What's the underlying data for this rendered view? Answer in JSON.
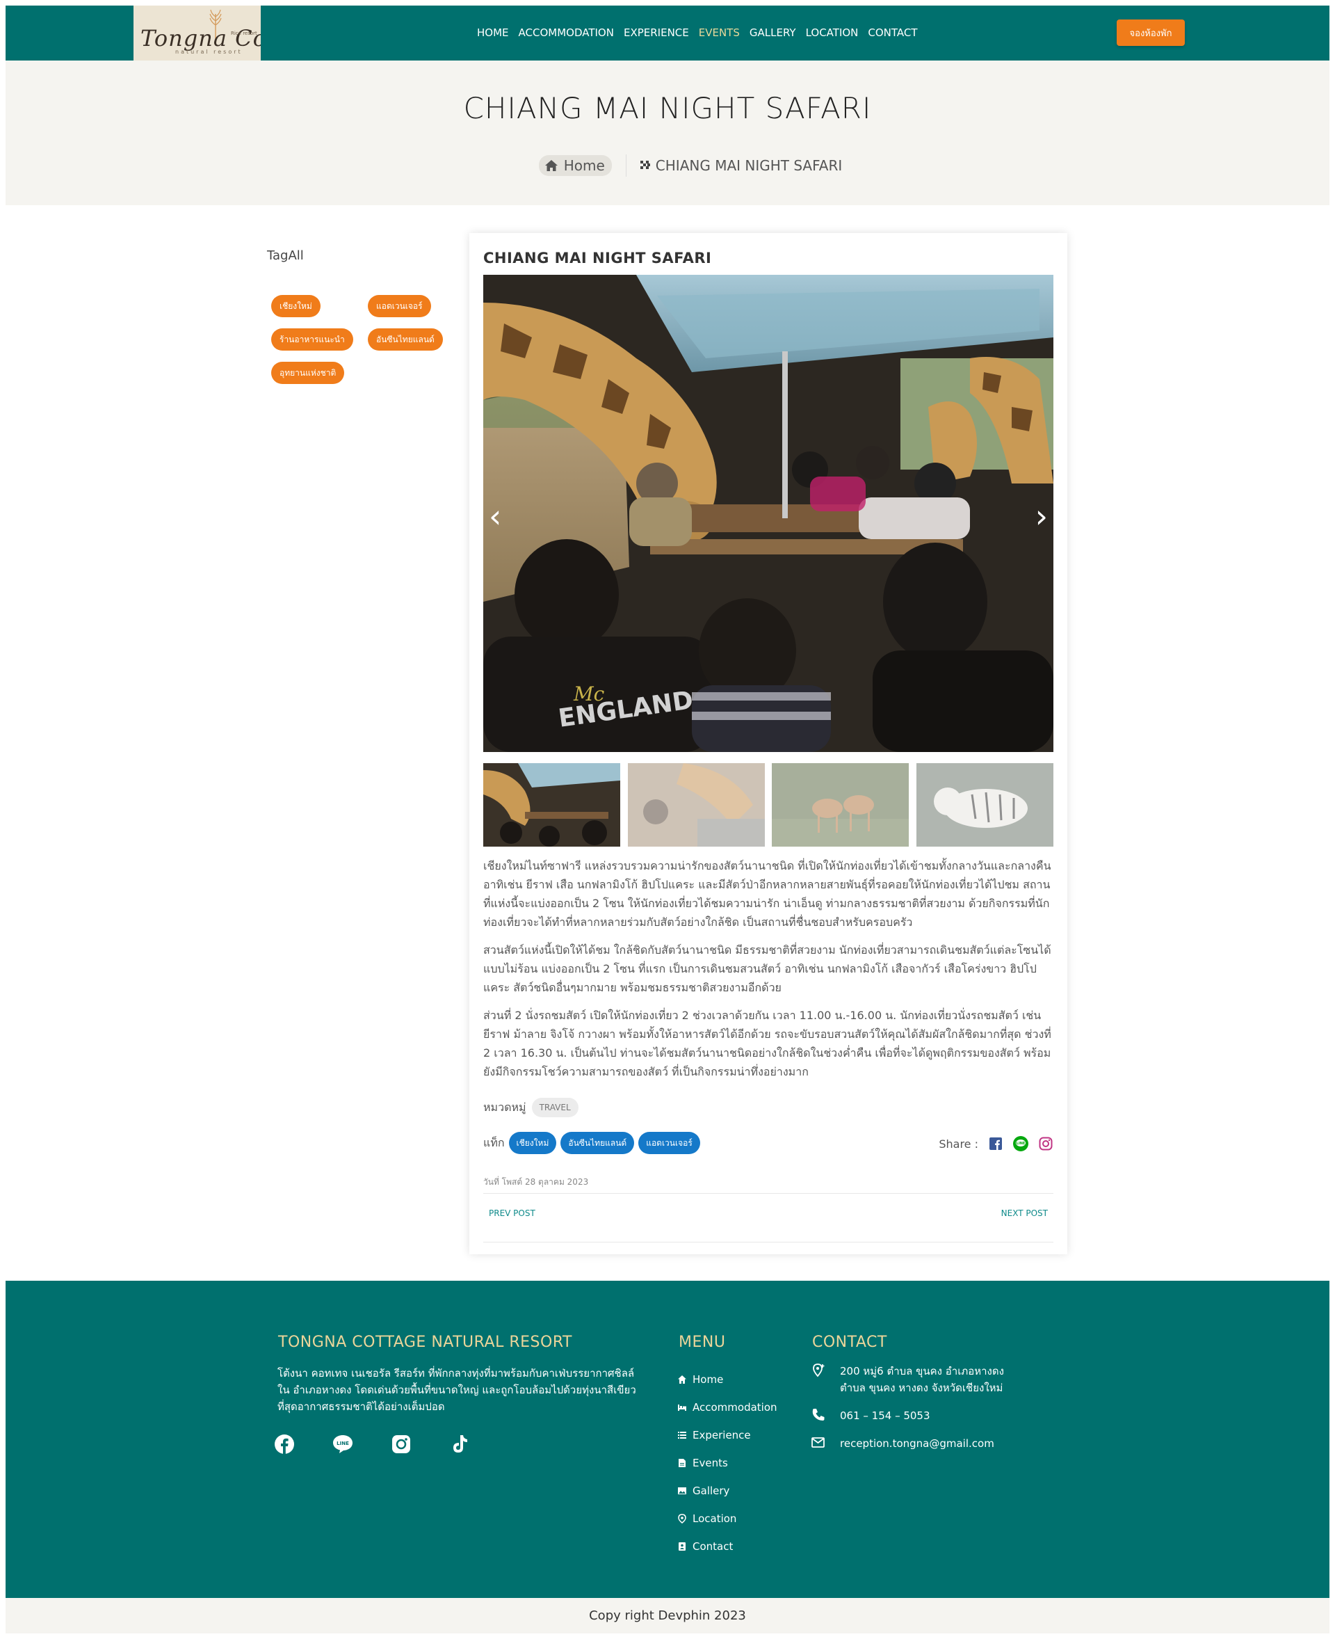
{
  "header": {
    "logo_text": "Tongna Co age",
    "logo_sub": "natural resort",
    "logo_small": "Rice resort",
    "nav": [
      {
        "label": "HOME",
        "active": false
      },
      {
        "label": "ACCOMMODATION",
        "active": false
      },
      {
        "label": "EXPERIENCE",
        "active": false
      },
      {
        "label": "EVENTS",
        "active": true
      },
      {
        "label": "GALLERY",
        "active": false
      },
      {
        "label": "LOCATION",
        "active": false
      },
      {
        "label": "CONTACT",
        "active": false
      }
    ],
    "book_label": "จองห้องพัก"
  },
  "hero": {
    "title": "CHIANG MAI NIGHT SAFARI",
    "breadcrumb_home": "Home",
    "breadcrumb_current": "CHIANG MAI NIGHT SAFARI"
  },
  "sidebar": {
    "title": "TagAll",
    "tags": [
      "เชียงใหม่",
      "แอดเวนเจอร์",
      "ร้านอาหารแนะนำ",
      "อันซีนไทยแลนด์",
      "อุทยานแห่งชาติ"
    ]
  },
  "post": {
    "title": "CHIANG MAI NIGHT SAFARI",
    "main_image_text": "Mc ENGLAND",
    "paragraphs": [
      "เชียงใหม่ไนท์ซาฟารี แหล่งรวบรวมความน่ารักของสัตว์นานาชนิด ที่เปิดให้นักท่องเที่ยวได้เข้าชมทั้งกลางวันและกลางคืน อาทิเช่น ยีราฟ เสือ นกฟลามิงโก้ ฮิปโปแคระ และมีสัตว์ป่าอีกหลากหลายสายพันธุ์ที่รอคอยให้นักท่องเที่ยวได้ไปชม สถานที่แห่งนี้จะแบ่งออกเป็น 2 โซน ให้นักท่องเที่ยวได้ชมความน่ารัก น่าเอ็นดู ท่ามกลางธรรมชาติที่สวยงาม ด้วยกิจกรรมที่นักท่องเที่ยวจะได้ทำที่หลากหลายร่วมกับสัตว์อย่างใกล้ชิด เป็นสถานที่ชื่นชอบสำหรับครอบครัว",
      "สวนสัตว์แห่งนี้เปิดให้ได้ชม ใกล้ชิดกับสัตว์นานาชนิด มีธรรมชาติที่สวยงาม นักท่องเที่ยวสามารถเดินชมสัตว์แต่ละโซนได้แบบไม่ร้อน แบ่งออกเป็น 2 โซน ที่แรก เป็นการเดินชมสวนสัตว์ อาทิเช่น นกฟลามิงโก้ เสือจากัวร์ เสือโคร่งขาว ฮิปโปแคระ สัตว์ชนิดอื่นๆมากมาย พร้อมชมธรรมชาติสวยงามอีกด้วย",
      "ส่วนที่ 2 นั่งรถชมสัตว์ เปิดให้นักท่องเที่ยว 2 ช่วงเวลาด้วยกัน เวลา 11.00 น.-16.00 น. นักท่องเที่ยวนั่งรถชมสัตว์ เช่น ยีราฟ ม้าลาย จิงโจ้ กวางผา พร้อมทั้งให้อาหารสัตว์ได้อีกด้วย รถจะขับรอบสวนสัตว์ให้คุณได้สัมผัสใกล้ชิดมากที่สุด ช่วงที่ 2 เวลา 16.30 น. เป็นต้นไป ท่านจะได้ชมสัตว์นานาชนิดอย่างใกล้ชิดในช่วงค่ำคืน เพื่อที่จะได้ดูพฤติกรรมของสัตว์ พร้อมยังมีกิจกรรมโชว์ความสามารถของสัตว์ ที่เป็นกิจกรรมน่าทึ่งอย่างมาก"
    ],
    "category_label": "หมวดหมู่",
    "category": "TRAVEL",
    "tags_label": "แท็ก",
    "tags": [
      "เชียงใหม่",
      "อันซีนไทยแลนด์",
      "แอดเวนเจอร์"
    ],
    "share_label": "Share :",
    "date": "วันที่ โพสต์ 28 ตุลาคม 2023",
    "prev_label": "PREV POST",
    "next_label": "NEXT POST"
  },
  "footer": {
    "brand_title": "TONGNA COTTAGE NATURAL RESORT",
    "about": "โต้งนา คอทเทจ เนเชอรัล รีสอร์ท ที่พักกลางทุ่งที่มาพร้อมกับคาเฟ่บรรยากาศชิลล์ใน อำเภอหางดง โดดเด่นด้วยพื้นที่ขนาดใหญ่ และถูกโอบล้อมไปด้วยทุ่งนาสีเขียว ที่สุดอากาศธรรมชาติได้อย่างเต็มปอด",
    "menu_title": "MENU",
    "menu": [
      {
        "label": "Home",
        "icon": "home-icon"
      },
      {
        "label": "Accommodation",
        "icon": "bed-icon"
      },
      {
        "label": "Experience",
        "icon": "list-icon"
      },
      {
        "label": "Events",
        "icon": "file-icon"
      },
      {
        "label": "Gallery",
        "icon": "image-icon"
      },
      {
        "label": "Location",
        "icon": "pin-icon"
      },
      {
        "label": "Contact",
        "icon": "contact-icon"
      }
    ],
    "contact_title": "CONTACT",
    "address": "200 หมู่6 ตำบล ขุนคง อำเภอหางดง ตำบล ขุนคง หางดง จังหวัดเชียงใหม่",
    "phone": "061 – 154 – 5053",
    "email": "reception.tongna@gmail.com"
  },
  "copyright": "Copy right Devphin 2023",
  "colors": {
    "primary": "#00706e",
    "accent": "#f07c1a",
    "tag_blue": "#1579c9",
    "footer_title": "#ebd59a"
  }
}
